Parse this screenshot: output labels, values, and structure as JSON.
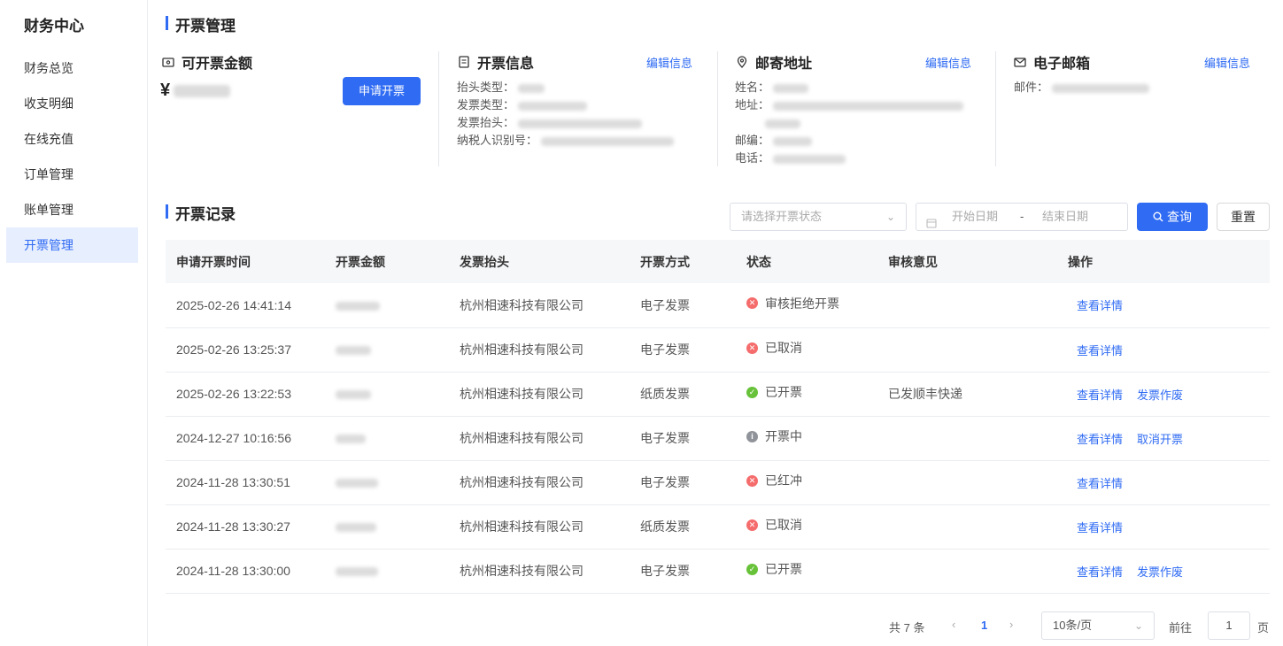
{
  "sidebar": {
    "title": "财务中心",
    "items": [
      {
        "label": "财务总览"
      },
      {
        "label": "收支明细"
      },
      {
        "label": "在线充值"
      },
      {
        "label": "订单管理"
      },
      {
        "label": "账单管理"
      },
      {
        "label": "开票管理"
      }
    ]
  },
  "page_title": "开票管理",
  "amount_card": {
    "title": "可开票金额",
    "currency": "¥",
    "apply_button": "申请开票"
  },
  "invoice_info": {
    "title": "开票信息",
    "edit": "编辑信息",
    "fields": [
      {
        "label": "抬头类型："
      },
      {
        "label": "发票类型："
      },
      {
        "label": "发票抬头："
      },
      {
        "label": "纳税人识别号："
      }
    ]
  },
  "mail_address": {
    "title": "邮寄地址",
    "edit": "编辑信息",
    "fields": [
      {
        "label": "姓名："
      },
      {
        "label": "地址："
      },
      {
        "label": "邮编："
      },
      {
        "label": "电话："
      }
    ]
  },
  "email": {
    "title": "电子邮箱",
    "edit": "编辑信息",
    "fields": [
      {
        "label": "邮件："
      }
    ]
  },
  "records": {
    "title": "开票记录",
    "filters": {
      "status_placeholder": "请选择开票状态",
      "start_date": "开始日期",
      "separator": "-",
      "end_date": "结束日期",
      "query": "查询",
      "reset": "重置"
    },
    "columns": [
      "申请开票时间",
      "开票金额",
      "发票抬头",
      "开票方式",
      "状态",
      "审核意见",
      "操作"
    ],
    "rows": [
      {
        "time": "2025-02-26 14:41:14",
        "title": "杭州相速科技有限公司",
        "method": "电子发票",
        "status": "审核拒绝开票",
        "status_type": "error",
        "review": "",
        "actions": [
          "查看详情"
        ]
      },
      {
        "time": "2025-02-26 13:25:37",
        "title": "杭州相速科技有限公司",
        "method": "电子发票",
        "status": "已取消",
        "status_type": "error",
        "review": "",
        "actions": [
          "查看详情"
        ]
      },
      {
        "time": "2025-02-26 13:22:53",
        "title": "杭州相速科技有限公司",
        "method": "纸质发票",
        "status": "已开票",
        "status_type": "success",
        "review": "已发顺丰快递",
        "actions": [
          "查看详情",
          "发票作废"
        ]
      },
      {
        "time": "2024-12-27 10:16:56",
        "title": "杭州相速科技有限公司",
        "method": "电子发票",
        "status": "开票中",
        "status_type": "info",
        "review": "",
        "actions": [
          "查看详情",
          "取消开票"
        ]
      },
      {
        "time": "2024-11-28 13:30:51",
        "title": "杭州相速科技有限公司",
        "method": "电子发票",
        "status": "已红冲",
        "status_type": "error",
        "review": "",
        "actions": [
          "查看详情"
        ]
      },
      {
        "time": "2024-11-28 13:30:27",
        "title": "杭州相速科技有限公司",
        "method": "纸质发票",
        "status": "已取消",
        "status_type": "error",
        "review": "",
        "actions": [
          "查看详情"
        ]
      },
      {
        "time": "2024-11-28 13:30:00",
        "title": "杭州相速科技有限公司",
        "method": "电子发票",
        "status": "已开票",
        "status_type": "success",
        "review": "",
        "actions": [
          "查看详情",
          "发票作废"
        ]
      }
    ]
  },
  "pagination": {
    "total": "共 7 条",
    "prev": "‹",
    "current": "1",
    "next": "›",
    "page_size": "10条/页",
    "goto_label": "前往",
    "goto_value": "1",
    "page_unit": "页"
  },
  "colors": {
    "accent": "#2f6bf3",
    "error": "#f56c6c",
    "success": "#67c23a",
    "info": "#909399"
  }
}
